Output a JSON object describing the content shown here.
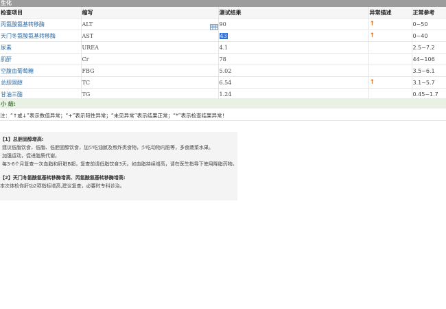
{
  "window": {
    "title": "生化"
  },
  "table": {
    "headers": {
      "name": "检查项目",
      "code": "缩写",
      "value": "测试结果",
      "abnormal": "异常描述",
      "reference": "正常参考"
    },
    "rows": [
      {
        "name": "丙氨酸氨基转移酶",
        "code": "ALT",
        "value": "90",
        "abnormal": "↑",
        "reference": "0~50"
      },
      {
        "name": "天门冬氨酸氨基转移酶",
        "code": "AST",
        "value": "43",
        "abnormal": "↑",
        "reference": "0~40"
      },
      {
        "name": "尿素",
        "code": "UREA",
        "value": "4.1",
        "abnormal": "",
        "reference": "2.5~7.2"
      },
      {
        "name": "肌酐",
        "code": "Cr",
        "value": "78",
        "abnormal": "",
        "reference": "44~106"
      },
      {
        "name": "空腹血葡萄糖",
        "code": "FBG",
        "value": "5.02",
        "abnormal": "",
        "reference": "3.5~6.1"
      },
      {
        "name": "总胆固醇",
        "code": "TC",
        "value": "6.54",
        "abnormal": "↑",
        "reference": "3.1~5.7"
      },
      {
        "name": "甘油三酯",
        "code": "TG",
        "value": "1.24",
        "abnormal": "",
        "reference": "0.45~1.7"
      }
    ]
  },
  "summary": {
    "label": "小 结:"
  },
  "note": {
    "text": "注：“↑或↓”表示数值异常；“+”表示阳性异常；“未见异常”表示结果正常；“*”表示检查结果异常！"
  },
  "advice": {
    "lines": [
      "【1】总胆固醇增高:",
      "建议低脂饮食，低脂、低胆固醇饮食，加少吃油腻及煎炸类食物，少吃动物内脏等，多食蔬菜水果。",
      "加强运动，促进脂质代谢。",
      "每3-6个月复查一次血脂和肝脏B超，复查前请低脂饮食3天。如血脂持续增高，请在医生指导下使用降脂药物。",
      "【2】天门冬氨酸氨基转移酶增高、丙氨酸氨基转移酶增高:",
      "本次体检你肝功2项指标增高,建议复查，必要时专科诊治。"
    ]
  }
}
